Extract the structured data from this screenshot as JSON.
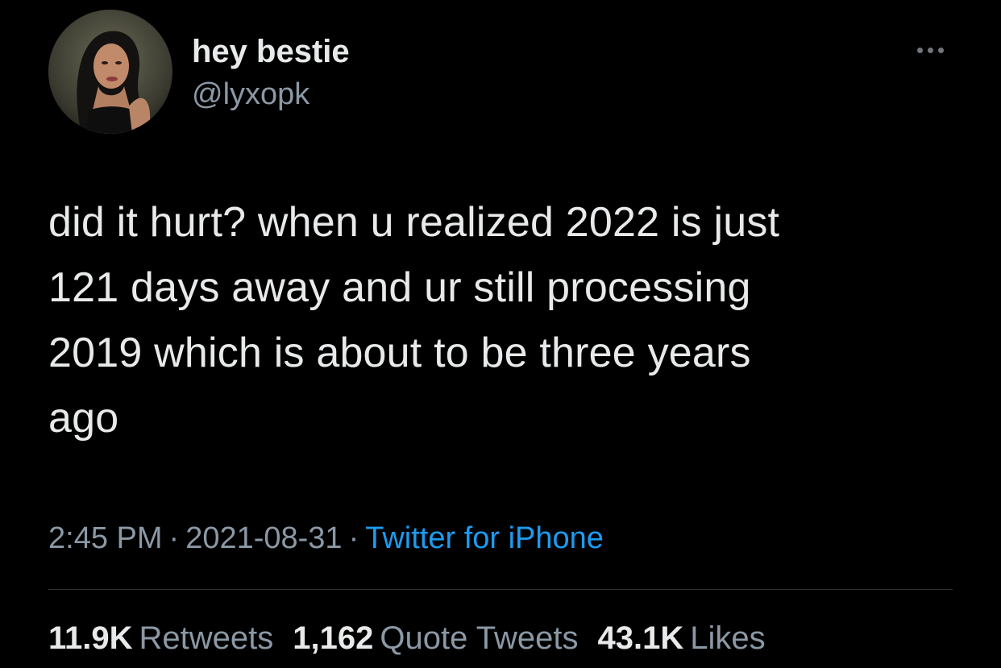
{
  "colors": {
    "background": "#000000",
    "primary_text": "#e7e9ea",
    "secondary_text": "#8b98a5",
    "accent_link": "#1d9bf0",
    "divider": "#2f3336"
  },
  "author": {
    "display_name": "hey bestie",
    "handle": "@lyxopk",
    "avatar_icon": "profile-photo"
  },
  "more_menu_icon": "more-horizontal-icon",
  "tweet": {
    "text": "did it hurt? when u realized 2022 is just\n121 days away and ur still processing\n2019 which is about to be three years\nago"
  },
  "meta": {
    "time": "2:45 PM",
    "separator": "·",
    "date": "2021-08-31",
    "source": "Twitter for iPhone"
  },
  "stats": {
    "retweets": {
      "count": "11.9K",
      "label": "Retweets"
    },
    "quote_tweets": {
      "count": "1,162",
      "label": "Quote Tweets"
    },
    "likes": {
      "count": "43.1K",
      "label": "Likes"
    }
  }
}
